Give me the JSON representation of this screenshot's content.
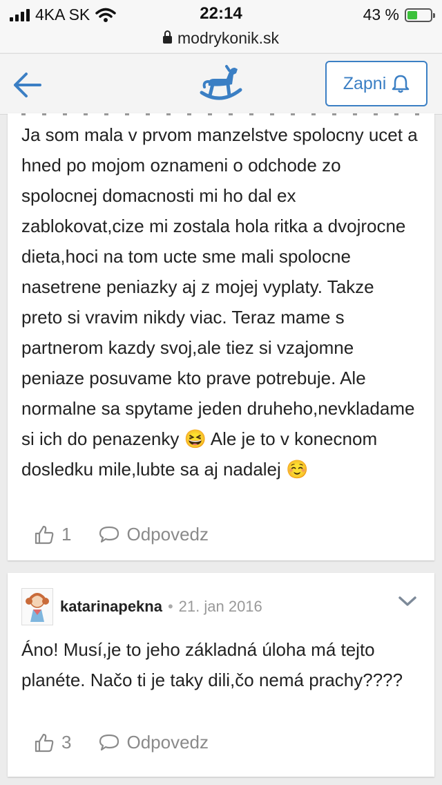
{
  "status_bar": {
    "carrier": "4KA SK",
    "time": "22:14",
    "battery": "43 %",
    "battery_level": 0.43,
    "url": "modrykonik.sk"
  },
  "app_bar": {
    "back_icon": "arrow-left-icon",
    "logo_icon": "rocking-horse-icon",
    "subscribe_label": "Zapni",
    "bell_icon": "bell-icon",
    "accent": "#3b7fc4"
  },
  "comments": [
    {
      "text": "Ja som mala v prvom manzelstve spolocny ucet a hned po mojom oznameni o odchode zo spolocnej domacnosti mi ho dal ex zablokovat,cize mi zostala hola ritka a dvojrocne dieta,hoci na tom ucte sme mali spolocne nasetrene peniazky aj z mojej vyplaty. Takze preto si vravim nikdy viac. Teraz mame s partnerom kazdy svoj,ale tiez si vzajomne peniaze posuvame kto prave potrebuje. Ale normalne sa spytame jeden druheho,nevkladame si ich do penazenky 😆 Ale je to v konecnom dosledku mile,lubte sa aj nadalej ☺️",
      "likes": "1",
      "reply_label": "Odpovedz"
    },
    {
      "author": "katarinapekna",
      "separator": "•",
      "date": "21. jan 2016",
      "text": "Áno! Musí,je to jeho základná úloha má tejto planéte. Načo ti je taky dili,čo nemá prachy????",
      "likes": "3",
      "reply_label": "Odpovedz"
    }
  ]
}
